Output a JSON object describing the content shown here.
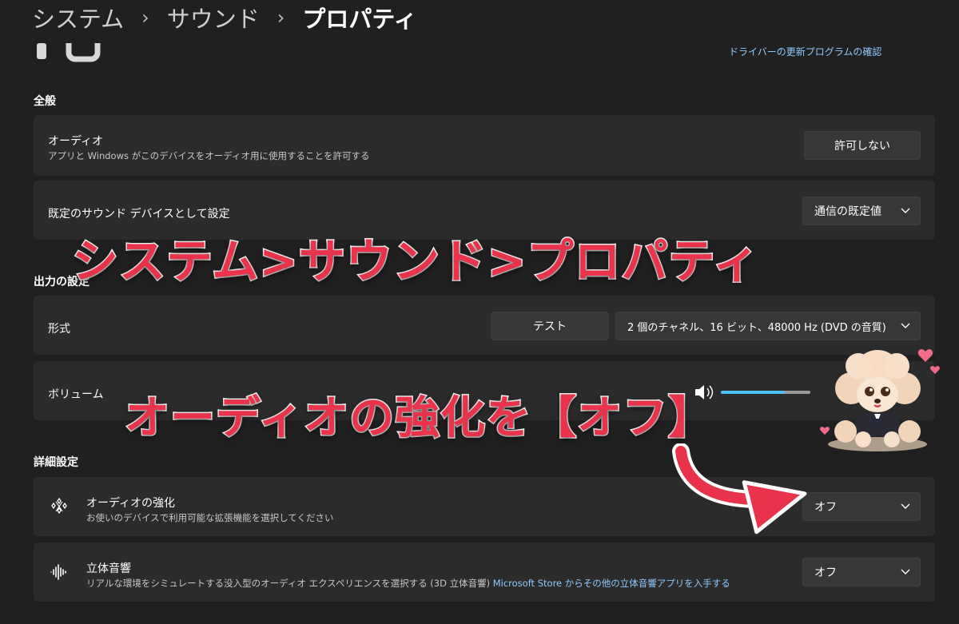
{
  "breadcrumb": {
    "items": [
      "システム",
      "サウンド",
      "プロパティ"
    ],
    "separator": "›"
  },
  "header": {
    "driver_update_link": "ドライバーの更新プログラムの確認"
  },
  "sections": {
    "general": "全般",
    "output": "出力の設定",
    "advanced": "詳細設定"
  },
  "general": {
    "audio": {
      "title": "オーディオ",
      "description": "アプリと Windows がこのデバイスをオーディオ用に使用することを許可する",
      "button_label": "許可しない"
    },
    "default_device": {
      "title": "既定のサウンド デバイスとして設定",
      "selected": "通信の既定値"
    }
  },
  "output": {
    "format": {
      "title": "形式",
      "test_label": "テスト",
      "selected": "2 個のチャネル、16 ビット、48000 Hz (DVD の音質)"
    },
    "volume": {
      "title": "ボリューム"
    }
  },
  "advanced": {
    "enhancement": {
      "title": "オーディオの強化",
      "description": "お使いのデバイスで利用可能な拡張機能を選択してください",
      "selected": "オフ",
      "icon": "sparkle-grid-icon"
    },
    "spatial": {
      "title": "立体音響",
      "description": "リアルな環境をシミュレートする没入型のオーディオ エクスペリエンスを選択する (3D 立体音響)",
      "store_link": "Microsoft Store からその他の立体音響アプリを入手する",
      "selected": "オフ",
      "icon": "sound-wave-icon"
    }
  },
  "overlay": {
    "headline": "システム>サウンド>プロパティ",
    "instruction": "オーディオの強化を【オフ】"
  },
  "colors": {
    "background": "#202020",
    "card": "#2b2b2b",
    "link": "#8fc9ff",
    "overlay_red": "#e8334a"
  }
}
